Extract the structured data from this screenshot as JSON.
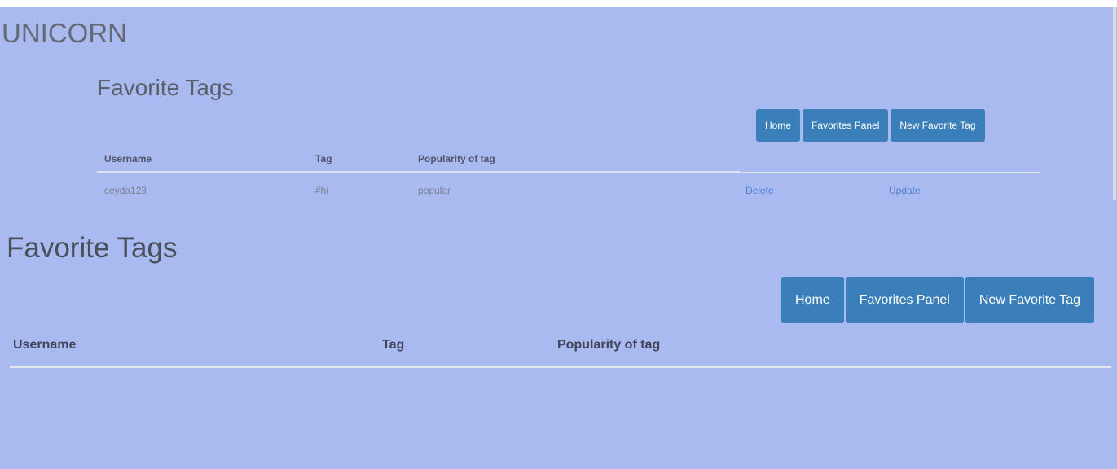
{
  "app": {
    "brand": "UNICORN"
  },
  "small_view": {
    "title": "Favorite Tags",
    "nav": {
      "home": "Home",
      "favorites_panel": "Favorites Panel",
      "new_favorite_tag": "New Favorite Tag"
    },
    "table": {
      "columns": [
        "Username",
        "Tag",
        "Popularity of tag"
      ],
      "rows": [
        {
          "username": "ceyda123",
          "tag": "#hi",
          "popularity": "popular",
          "delete": "Delete",
          "update": "Update"
        }
      ]
    }
  },
  "large_view": {
    "title": "Favorite Tags",
    "nav": {
      "home": "Home",
      "favorites_panel": "Favorites Panel",
      "new_favorite_tag": "New Favorite Tag"
    },
    "table": {
      "columns": [
        "Username",
        "Tag",
        "Popularity of tag"
      ]
    }
  },
  "colors": {
    "background": "#a9baf0",
    "button": "#3a7fb9",
    "link": "#4f7fd0"
  }
}
